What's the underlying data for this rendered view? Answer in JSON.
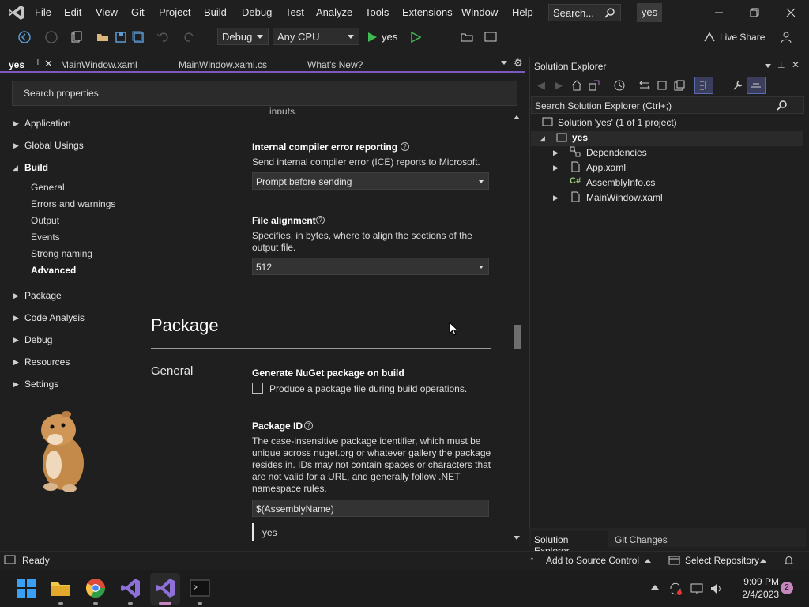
{
  "menu": {
    "items": [
      "File",
      "Edit",
      "View",
      "Git",
      "Project",
      "Build",
      "Debug",
      "Test",
      "Analyze",
      "Tools",
      "Extensions",
      "Window",
      "Help"
    ],
    "search_placeholder": "Search...",
    "solution_name": "yes"
  },
  "toolbar": {
    "config": "Debug",
    "platform": "Any CPU",
    "run_target": "yes",
    "live_share": "Live Share"
  },
  "doc_tabs": [
    {
      "label": "yes",
      "active": true
    },
    {
      "label": "MainWindow.xaml",
      "active": false
    },
    {
      "label": "MainWindow.xaml.cs",
      "active": false
    },
    {
      "label": "What's New?",
      "active": false
    }
  ],
  "properties": {
    "search_placeholder": "Search properties",
    "nav": [
      {
        "label": "Application",
        "expanded": false
      },
      {
        "label": "Global Usings",
        "expanded": false
      },
      {
        "label": "Build",
        "expanded": true,
        "children": [
          "General",
          "Errors and warnings",
          "Output",
          "Events",
          "Strong naming",
          "Advanced"
        ],
        "selected": "Advanced"
      },
      {
        "label": "Package",
        "expanded": false
      },
      {
        "label": "Code Analysis",
        "expanded": false
      },
      {
        "label": "Debug",
        "expanded": false
      },
      {
        "label": "Resources",
        "expanded": false
      },
      {
        "label": "Settings",
        "expanded": false
      }
    ],
    "ice": {
      "title": "Internal compiler error reporting",
      "desc": "Send internal compiler error (ICE) reports to Microsoft.",
      "value": "Prompt before sending"
    },
    "file_alignment": {
      "title": "File alignment",
      "desc_1": "Specifies, in bytes, where to align the sections of the",
      "desc_2": "output file.",
      "value": "512"
    },
    "package_section": "Package",
    "general_section": "General",
    "nuget": {
      "title": "Generate NuGet package on build",
      "checkbox_label": "Produce a package file during build operations.",
      "checked": false
    },
    "package_id": {
      "title": "Package ID",
      "desc_1": "The case-insensitive package identifier, which must be",
      "desc_2": "unique across nuget.org or whatever gallery the package",
      "desc_3": "resides in. IDs may not contain spaces or characters that",
      "desc_4": "are not valid for a URL, and generally follow .NET",
      "desc_5": "namespace rules.",
      "value": "$(AssemblyName)",
      "preview": "yes"
    }
  },
  "solution_explorer": {
    "title": "Solution Explorer",
    "search_placeholder": "Search Solution Explorer (Ctrl+;)",
    "solution_label": "Solution 'yes' (1 of 1 project)",
    "project": "yes",
    "items": [
      "Dependencies",
      "App.xaml",
      "AssemblyInfo.cs",
      "MainWindow.xaml"
    ],
    "tabs": [
      "Solution Explorer",
      "Git Changes"
    ]
  },
  "status": {
    "ready": "Ready",
    "add_source": "Add to Source Control",
    "select_repo": "Select Repository"
  },
  "taskbar": {
    "time": "9:09 PM",
    "date": "2/4/2023",
    "notifications": "2"
  },
  "colors": {
    "accent": "#7e57c2",
    "background": "#1f1f1f"
  }
}
